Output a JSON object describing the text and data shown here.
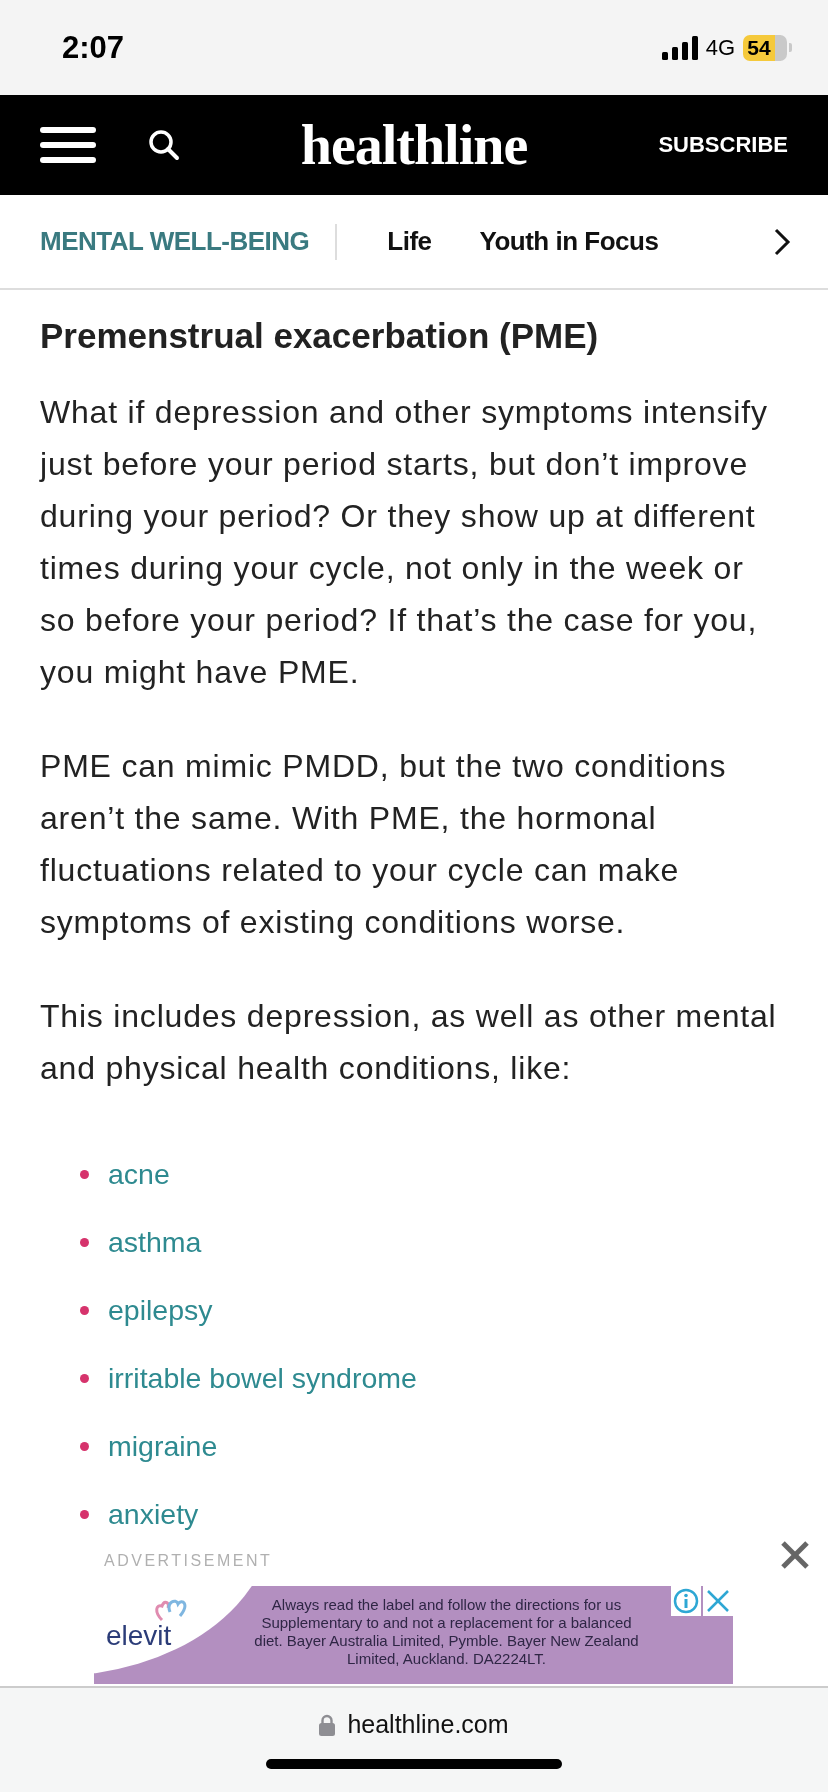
{
  "status_bar": {
    "time": "2:07",
    "network": "4G",
    "battery": "54"
  },
  "header": {
    "logo": "healthline",
    "subscribe": "SUBSCRIBE"
  },
  "nav_tabs": [
    {
      "label": "MENTAL WELL-BEING",
      "selected": true
    },
    {
      "label": "Life",
      "selected": false
    },
    {
      "label": "Youth in Focus",
      "selected": false
    }
  ],
  "article": {
    "heading": "Premenstrual exacerbation (PME)",
    "paragraphs": [
      "What if depression and other symptoms intensify just before your period starts, but don’t improve during your period? Or they show up at different times during your cycle, not only in the week or so before your period? If that’s the case for you, you might have PME.",
      "PME can mimic PMDD, but the two conditions aren’t the same. With PME, the hormonal fluctuations related to your cycle can make symptoms of existing conditions worse.",
      "This includes depression, as well as other mental and physical health conditions, like:"
    ],
    "list": [
      "acne",
      "asthma",
      "epilepsy",
      "irritable bowel syndrome",
      "migraine",
      "anxiety"
    ]
  },
  "ad": {
    "label": "ADVERTISEMENT",
    "brand": "elevit",
    "text": "Always read the label and follow the directions for us\nSupplementary to and not a replacement for a balanced\ndiet. Bayer Australia Limited, Pymble. Bayer New Zealand\nLimited, Auckland. DA2224LT."
  },
  "browser": {
    "url": "healthline.com"
  }
}
